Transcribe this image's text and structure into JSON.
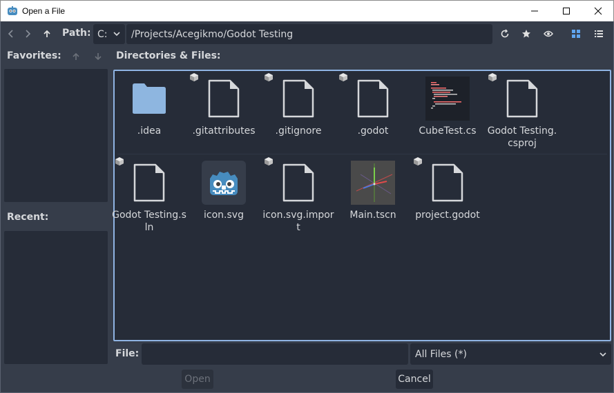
{
  "window": {
    "title": "Open a File"
  },
  "toolbar": {
    "path_label": "Path:",
    "drive": "C:",
    "path": "/Projects/Acegikmo/Godot Testing"
  },
  "left": {
    "favorites_label": "Favorites:",
    "recent_label": "Recent:"
  },
  "files_label": "Directories & Files:",
  "files": [
    {
      "name": ".idea",
      "kind": "folder"
    },
    {
      "name": ".gitattributes",
      "kind": "file"
    },
    {
      "name": ".gitignore",
      "kind": "file"
    },
    {
      "name": ".godot",
      "kind": "file"
    },
    {
      "name": "CubeTest.cs",
      "kind": "script-thumb"
    },
    {
      "name": "Godot Testing.csproj",
      "kind": "file"
    },
    {
      "name": "Godot Testing.sln",
      "kind": "file"
    },
    {
      "name": "icon.svg",
      "kind": "godot-icon"
    },
    {
      "name": "icon.svg.import",
      "kind": "file"
    },
    {
      "name": "Main.tscn",
      "kind": "scene-thumb"
    },
    {
      "name": "project.godot",
      "kind": "file"
    }
  ],
  "bottom": {
    "file_label": "File:",
    "file_value": "",
    "filter": "All Files (*)",
    "open_label": "Open",
    "cancel_label": "Cancel"
  },
  "colors": {
    "background": "#363d4a",
    "panel": "#262c38",
    "accent": "#8fb4e3",
    "folder": "#8eb6e0"
  }
}
